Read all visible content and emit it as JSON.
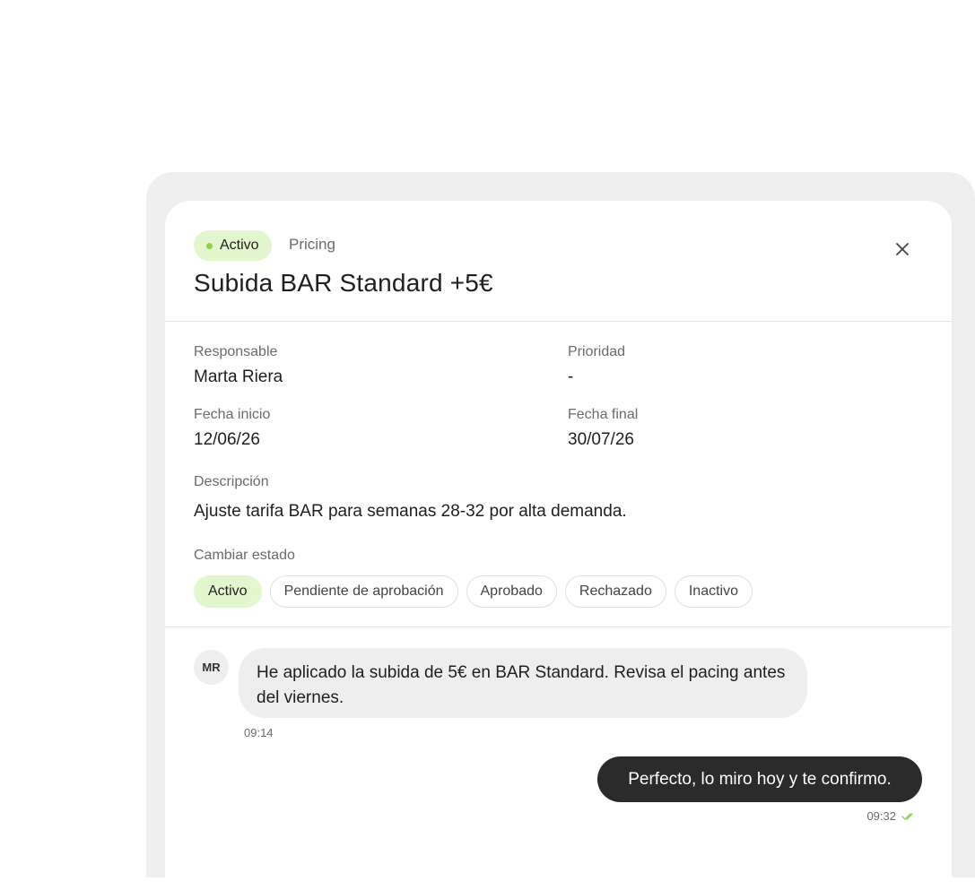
{
  "header": {
    "status": "Activo",
    "category": "Pricing",
    "title": "Subida BAR Standard +5€"
  },
  "details": {
    "responsable_label": "Responsable",
    "responsable_value": "Marta Riera",
    "prioridad_label": "Prioridad",
    "prioridad_value": "-",
    "fecha_inicio_label": "Fecha inicio",
    "fecha_inicio_value": "12/06/26",
    "fecha_final_label": "Fecha final",
    "fecha_final_value": "30/07/26",
    "descripcion_label": "Descripción",
    "descripcion_value": "Ajuste tarifa BAR para semanas 28-32 por alta demanda.",
    "cambiar_estado_label": "Cambiar estado"
  },
  "status_options": [
    "Activo",
    "Pendiente de aprobación",
    "Aprobado",
    "Rechazado",
    "Inactivo"
  ],
  "selected_status": "Activo",
  "chat": {
    "incoming": {
      "avatar_initials": "MR",
      "text": "He aplicado la subida de 5€ en BAR Standard. Revisa el pacing antes del viernes.",
      "time": "09:14"
    },
    "outgoing": {
      "text": "Perfecto, lo miro hoy y te confirmo.",
      "time": "09:32"
    }
  },
  "colors": {
    "accent_bg": "#e2f7cd",
    "accent_dot": "#8fd14f",
    "outgoing_bubble": "#2b2b2b",
    "incoming_bubble": "#eeeeee"
  },
  "icons": {
    "close": "close-icon",
    "read_receipt": "double-check-icon"
  }
}
